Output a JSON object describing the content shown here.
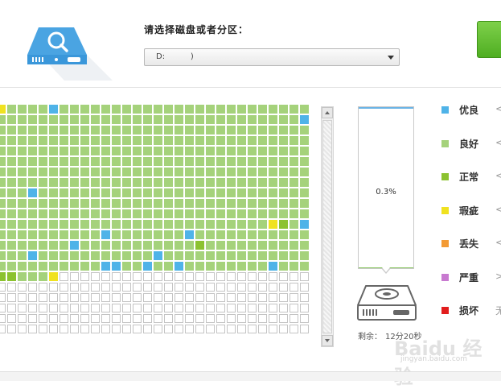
{
  "header": {
    "prompt": "请选择磁盘或者分区：",
    "disk_select_value": "D:          )"
  },
  "colors": {
    "good": "#a5d27b",
    "excellent": "#4fb3e8",
    "normal": "#8cc230",
    "flawed": "#f0e220",
    "lost": "#f39a34",
    "severe": "#c87ad0",
    "damaged": "#e21d1d",
    "unscanned": "#ffffff",
    "cell_border": "#ffffff",
    "unscanned_border": "#c4c4c4"
  },
  "block_map": {
    "columns": 30,
    "rows": 22,
    "scanned_full_rows": 16,
    "scanned_partial_columns_row16": 6,
    "special_cells": [
      {
        "row": 0,
        "col": 0,
        "status": "flawed"
      },
      {
        "row": 0,
        "col": 5,
        "status": "excellent"
      },
      {
        "row": 1,
        "col": 29,
        "status": "excellent"
      },
      {
        "row": 8,
        "col": 3,
        "status": "excellent"
      },
      {
        "row": 11,
        "col": 26,
        "status": "flawed"
      },
      {
        "row": 11,
        "col": 27,
        "status": "normal"
      },
      {
        "row": 11,
        "col": 29,
        "status": "excellent"
      },
      {
        "row": 12,
        "col": 10,
        "status": "excellent"
      },
      {
        "row": 12,
        "col": 18,
        "status": "excellent"
      },
      {
        "row": 13,
        "col": 7,
        "status": "excellent"
      },
      {
        "row": 13,
        "col": 19,
        "status": "normal"
      },
      {
        "row": 14,
        "col": 3,
        "status": "excellent"
      },
      {
        "row": 14,
        "col": 15,
        "status": "excellent"
      },
      {
        "row": 15,
        "col": 10,
        "status": "excellent"
      },
      {
        "row": 15,
        "col": 11,
        "status": "excellent"
      },
      {
        "row": 15,
        "col": 14,
        "status": "excellent"
      },
      {
        "row": 15,
        "col": 17,
        "status": "excellent"
      },
      {
        "row": 15,
        "col": 26,
        "status": "excellent"
      },
      {
        "row": 16,
        "col": 0,
        "status": "normal"
      },
      {
        "row": 16,
        "col": 1,
        "status": "normal"
      },
      {
        "row": 16,
        "col": 5,
        "status": "flawed"
      }
    ]
  },
  "progress": {
    "percent_text": "0.3%",
    "fraction": 0.003,
    "remaining_label": "剩余：",
    "remaining_value": "12分20秒"
  },
  "legend": [
    {
      "label": "优良",
      "color_key": "excellent",
      "tail": "<"
    },
    {
      "label": "良好",
      "color_key": "good",
      "tail": "<"
    },
    {
      "label": "正常",
      "color_key": "normal",
      "tail": "<"
    },
    {
      "label": "瑕疵",
      "color_key": "flawed",
      "tail": "<"
    },
    {
      "label": "丢失",
      "color_key": "lost",
      "tail": "<"
    },
    {
      "label": "严重",
      "color_key": "severe",
      "tail": ">"
    },
    {
      "label": "损坏",
      "color_key": "damaged",
      "tail": "无"
    }
  ],
  "watermark": {
    "text": "Baidu 经验",
    "url": "jingyan.baidu.com"
  }
}
